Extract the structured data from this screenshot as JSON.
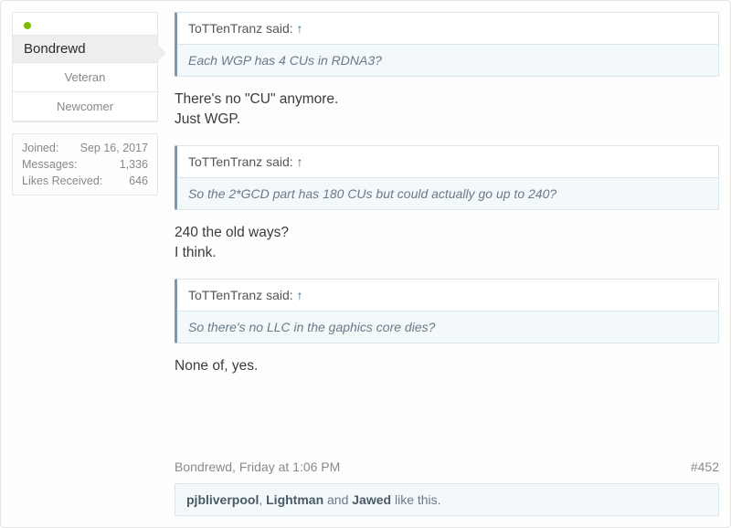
{
  "user": {
    "name": "Bondrewd",
    "rank1": "Veteran",
    "rank2": "Newcomer",
    "stats": {
      "joined_label": "Joined:",
      "joined_value": "Sep 16, 2017",
      "messages_label": "Messages:",
      "messages_value": "1,336",
      "likes_label": "Likes Received:",
      "likes_value": "646"
    }
  },
  "quotes": [
    {
      "author": "ToTTenTranz said:",
      "arrow": "↑",
      "body": "Each WGP has 4 CUs in RDNA3?"
    },
    {
      "author": "ToTTenTranz said:",
      "arrow": "↑",
      "body": "So the 2*GCD part has 180 CUs but could actually go up to 240?"
    },
    {
      "author": "ToTTenTranz said:",
      "arrow": "↑",
      "body": "So there's no LLC in the gaphics core dies?"
    }
  ],
  "replies": [
    "There's no \"CU\" anymore.\nJust WGP.",
    "240 the old ways?\nI think.",
    "None of, yes."
  ],
  "meta": {
    "author_time": "Bondrewd, Friday at 1:06 PM",
    "post_number": "#452"
  },
  "likes": {
    "u1": "pjbliverpool",
    "sep1": ", ",
    "u2": "Lightman",
    "sep2": " and ",
    "u3": "Jawed",
    "tail": " like this."
  }
}
